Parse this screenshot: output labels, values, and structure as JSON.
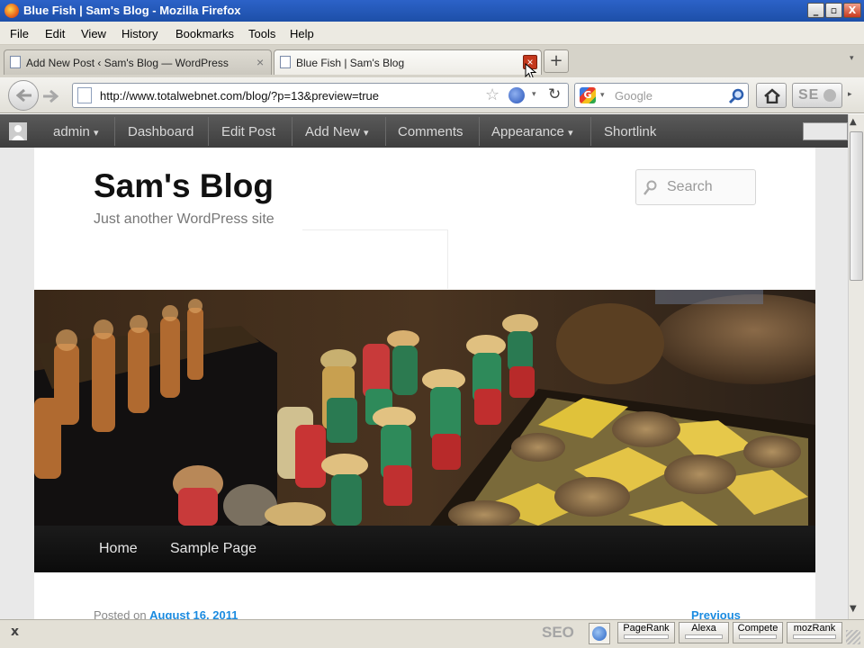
{
  "window": {
    "title": "Blue Fish | Sam's Blog - Mozilla Firefox",
    "controls": [
      "_",
      "▫",
      "X"
    ]
  },
  "menubar": [
    "File",
    "Edit",
    "View",
    "History",
    "Bookmarks",
    "Tools",
    "Help"
  ],
  "tabs": [
    {
      "label": "Add New Post ‹ Sam's Blog — WordPress",
      "active": false
    },
    {
      "label": "Blue Fish | Sam's Blog",
      "active": true
    }
  ],
  "tab_new": "+",
  "tab_close": "×",
  "address": {
    "url": "http://www.totalwebnet.com/blog/?p=13&preview=true"
  },
  "search": {
    "placeholder": "Google",
    "engine": "G"
  },
  "seo_button": "SE",
  "admin_bar": {
    "user": "admin",
    "items": [
      "Dashboard",
      "Edit Post",
      "Add New",
      "Comments",
      "Appearance",
      "Shortlink"
    ],
    "dropdown_marker": "▾"
  },
  "site": {
    "title": "Sam's Blog",
    "tagline": "Just another WordPress site",
    "search_placeholder": "Search"
  },
  "nav": [
    "Home",
    "Sample Page"
  ],
  "post": {
    "posted_on": "Posted on",
    "date": "August 16, 2011",
    "previous": "Previous"
  },
  "statusbar": {
    "close": "x",
    "seo": "SEO",
    "items": [
      "PageRank",
      "Alexa",
      "Compete",
      "mozRank"
    ]
  },
  "colors": {
    "titlebar": "#2c62c8",
    "adminbar": "#464646",
    "link": "#1b8be0",
    "nav": "#111111"
  }
}
